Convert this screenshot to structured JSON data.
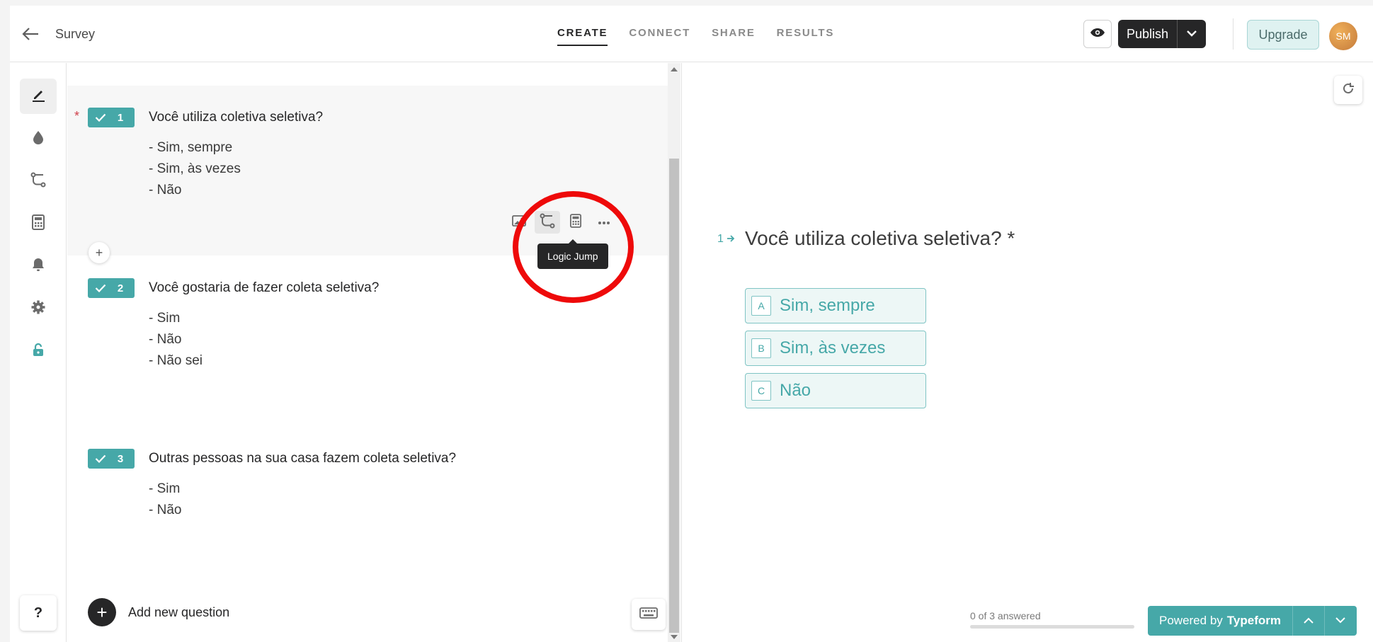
{
  "header": {
    "title": "Survey",
    "tabs": [
      {
        "label": "CREATE",
        "active": true
      },
      {
        "label": "CONNECT",
        "active": false
      },
      {
        "label": "SHARE",
        "active": false
      },
      {
        "label": "RESULTS",
        "active": false
      }
    ],
    "publish_label": "Publish",
    "upgrade_label": "Upgrade",
    "avatar_initials": "SM"
  },
  "toolbar": {
    "icons": [
      "pen-icon",
      "drop-icon",
      "logic-jump-icon",
      "calculator-icon",
      "bell-icon",
      "gear-icon",
      "lock-icon"
    ],
    "help_label": "?"
  },
  "questions": [
    {
      "number": "1",
      "required": true,
      "title": "Você utiliza coletiva seletiva?",
      "options": [
        "- Sim, sempre",
        "- Sim, às vezes",
        "- Não"
      ]
    },
    {
      "number": "2",
      "required": false,
      "title": "Você gostaria de fazer coleta seletiva?",
      "options": [
        "- Sim",
        "- Não",
        "- Não sei"
      ]
    },
    {
      "number": "3",
      "required": false,
      "title": "Outras pessoas na sua casa fazem coleta seletiva?",
      "options": [
        "- Sim",
        "- Não"
      ]
    }
  ],
  "question_actions": [
    "image-icon",
    "logic-jump-icon",
    "calculator-icon",
    "more-icon"
  ],
  "tooltip": "Logic Jump",
  "add_question_label": "Add new question",
  "add_between_label": "+",
  "preview": {
    "question_number": "1",
    "question_title": "Você utiliza coletiva seletiva? *",
    "choices": [
      {
        "key": "A",
        "label": "Sim, sempre"
      },
      {
        "key": "B",
        "label": "Sim, às vezes"
      },
      {
        "key": "C",
        "label": "Não"
      }
    ],
    "progress_text": "0 of 3 answered",
    "progress_fraction": 0,
    "powered_prefix": "Powered by",
    "powered_brand": "Typeform"
  },
  "colors": {
    "accent": "#46a8a8",
    "dark": "#262627",
    "required": "#d0404b",
    "annotation_ring": "#ee0a0a"
  }
}
